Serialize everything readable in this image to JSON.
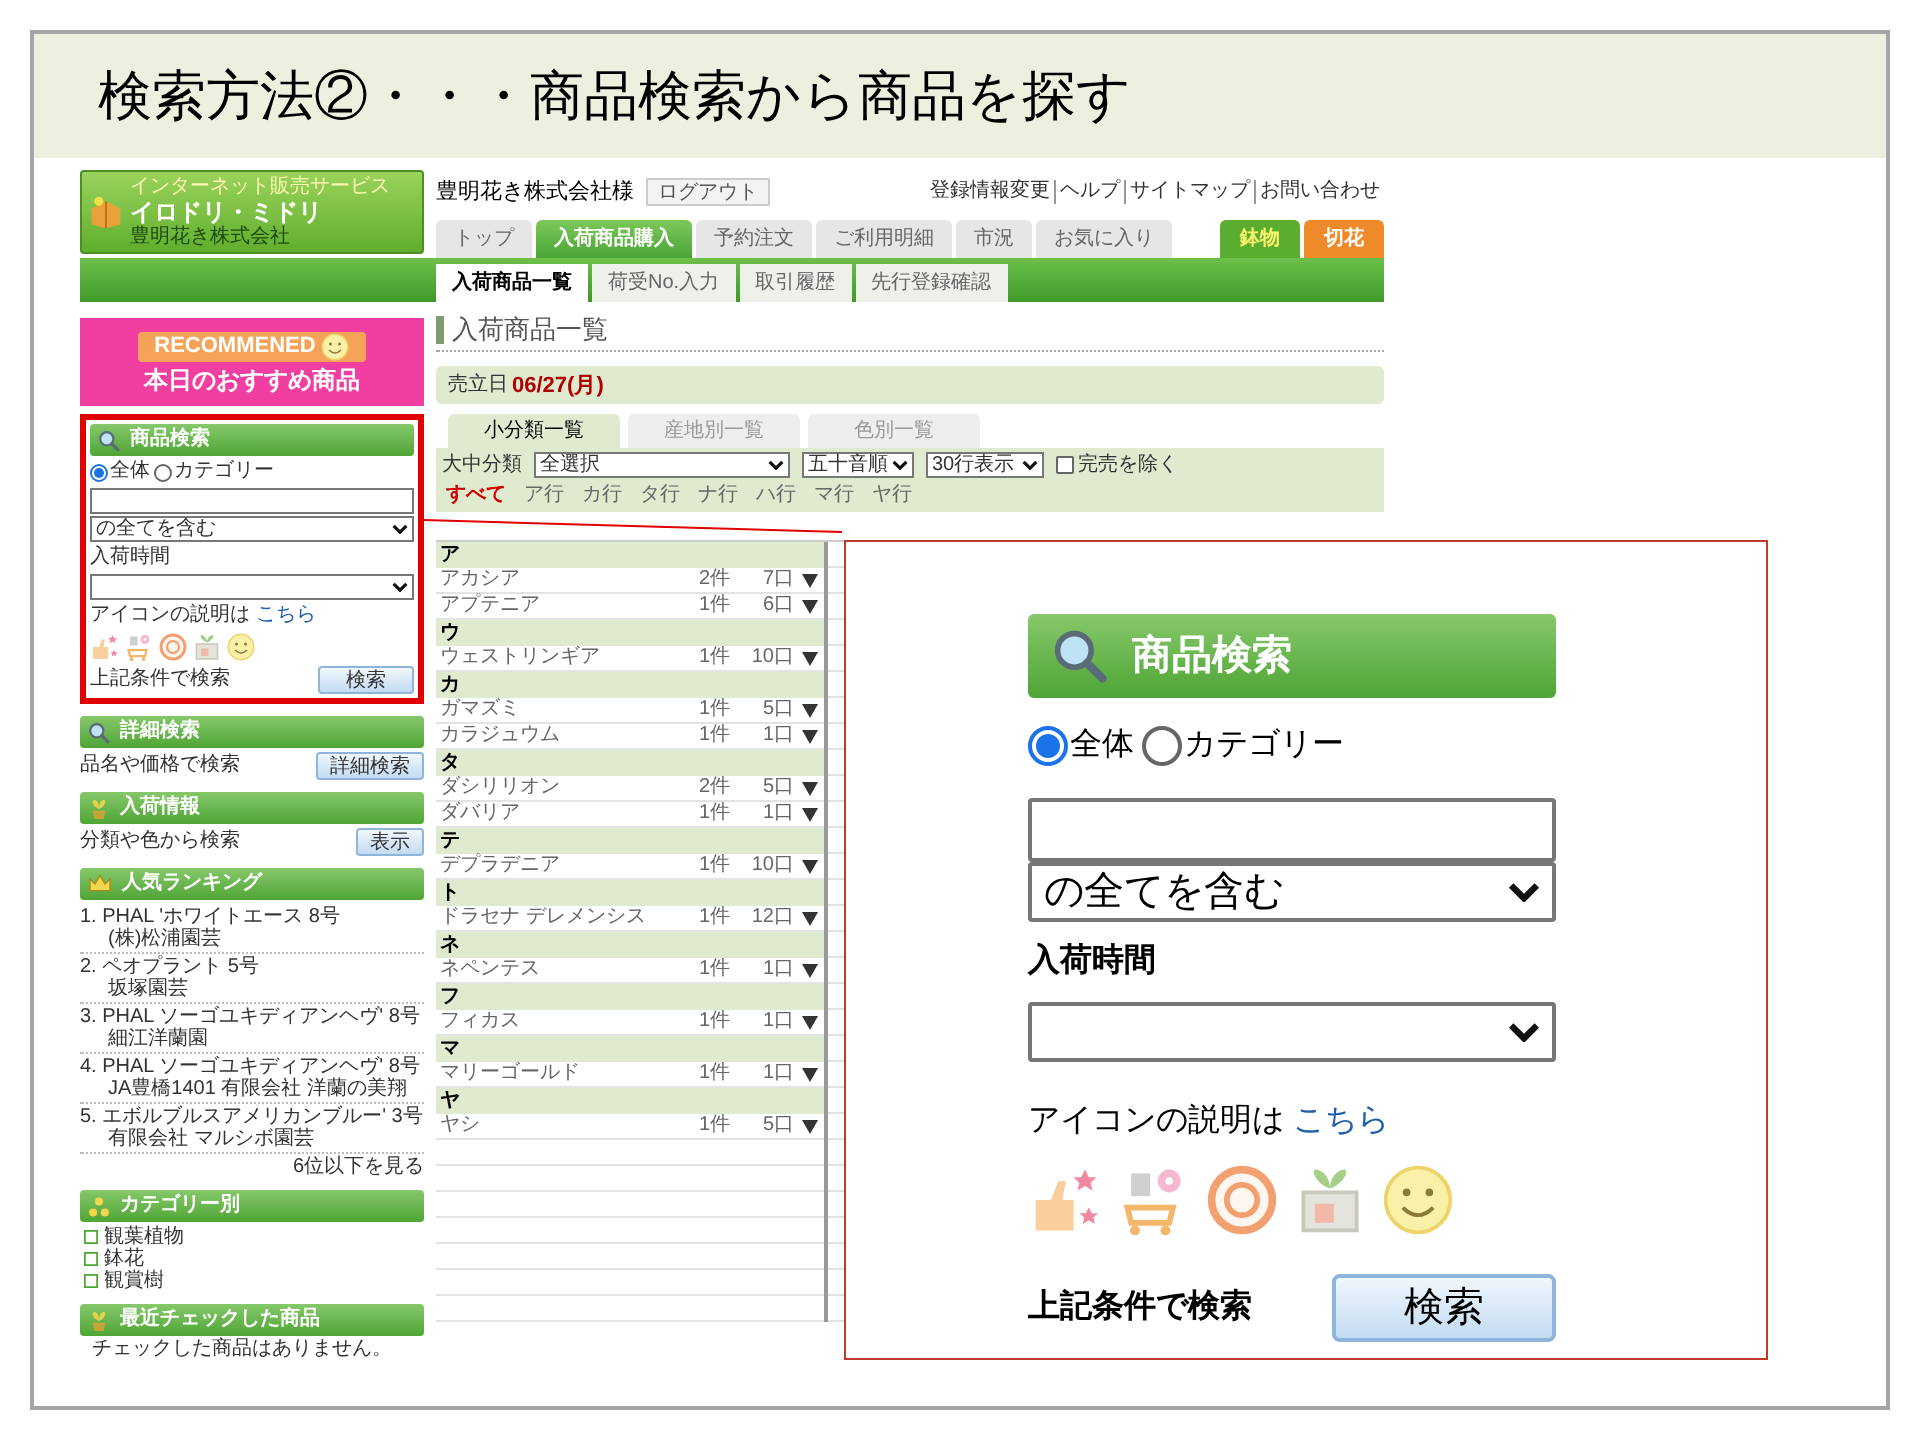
{
  "slide": {
    "title": "検索方法②・・・商品検索から商品を探す"
  },
  "header": {
    "logo": {
      "tagline": "インターネット販売サービス",
      "name": "イロドリ・ミドリ",
      "company": "豊明花き株式会社"
    },
    "user": "豊明花き株式会社様",
    "logout": "ログアウト",
    "links": [
      "登録情報変更",
      "ヘルプ",
      "サイトマップ",
      "お問い合わせ"
    ]
  },
  "nav": {
    "tabs": [
      {
        "label": "トップ",
        "selected": false
      },
      {
        "label": "入荷商品購入",
        "selected": true
      },
      {
        "label": "予約注文",
        "selected": false
      },
      {
        "label": "ご利用明細",
        "selected": false
      },
      {
        "label": "市況",
        "selected": false
      },
      {
        "label": "お気に入り",
        "selected": false
      }
    ],
    "markets": [
      {
        "label": "鉢物",
        "color": "#5aad2f"
      },
      {
        "label": "切花",
        "color": "#ee8a2a"
      }
    ],
    "sub_tabs": [
      {
        "label": "入荷商品一覧",
        "selected": true
      },
      {
        "label": "荷受No.入力",
        "selected": false
      },
      {
        "label": "取引履歴",
        "selected": false
      },
      {
        "label": "先行登録確認",
        "selected": false
      }
    ]
  },
  "sidebar": {
    "banner": {
      "badge": "RECOMMENED",
      "text": "本日のおすすめ商品"
    },
    "search": {
      "title": "商品検索",
      "scope": [
        {
          "label": "全体",
          "selected": true
        },
        {
          "label": "カテゴリー",
          "selected": false
        }
      ],
      "keyword_mode": "の全てを含む",
      "time_label": "入荷時間",
      "icon_note": "アイコンの説明は",
      "icon_link": "こちら",
      "submit_label": "上記条件で検索",
      "submit": "検索"
    },
    "detail": {
      "title": "詳細検索",
      "note": "品名や価格で検索",
      "button": "詳細検索"
    },
    "arrivals": {
      "title": "入荷情報",
      "note": "分類や色から検索",
      "button": "表示"
    },
    "ranking": {
      "title": "人気ランキング",
      "entries": [
        {
          "name": "1. PHAL 'ホワイトエース 8号",
          "grower": "(株)松浦園芸"
        },
        {
          "name": "2. ペオプラント 5号",
          "grower": "坂塚園芸"
        },
        {
          "name": "3. PHAL ソーゴユキディアンヘヴ' 8号",
          "grower": "細江洋蘭園"
        },
        {
          "name": "4. PHAL ソーゴユキディアンヘヴ' 8号",
          "grower": "JA豊橋1401 有限会社 洋蘭の美翔"
        },
        {
          "name": "5. エボルブルスアメリカンブルー' 3号",
          "grower": "有限会社 マルシボ園芸"
        }
      ],
      "more": "6位以下を見る"
    },
    "categories": {
      "title": "カテゴリー別",
      "items": [
        "観葉植物",
        "鉢花",
        "観賞樹"
      ]
    },
    "recent": {
      "title": "最近チェックした商品",
      "empty": "チェックした商品はありません。"
    }
  },
  "main": {
    "title": "入荷商品一覧",
    "date_label": "売立日",
    "date": "06/27(月)",
    "views": [
      {
        "label": "小分類一覧",
        "selected": true
      },
      {
        "label": "産地別一覧",
        "selected": false
      },
      {
        "label": "色別一覧",
        "selected": false
      }
    ],
    "filters": {
      "class_label": "大中分類",
      "class_value": "全選択",
      "sort": "五十音順",
      "rows": "30行表示",
      "exclude_label": "完売を除く",
      "exclude": false
    },
    "kana": [
      {
        "label": "すべて",
        "selected": true
      },
      {
        "label": "ア行",
        "selected": false
      },
      {
        "label": "カ行",
        "selected": false
      },
      {
        "label": "タ行",
        "selected": false
      },
      {
        "label": "ナ行",
        "selected": false
      },
      {
        "label": "ハ行",
        "selected": false
      },
      {
        "label": "マ行",
        "selected": false
      },
      {
        "label": "ヤ行",
        "selected": false
      }
    ],
    "groups": [
      {
        "heading": "ア",
        "items": [
          {
            "name": "アカシア",
            "count": "2件",
            "qty": "7口"
          },
          {
            "name": "アプテニア",
            "count": "1件",
            "qty": "6口"
          }
        ]
      },
      {
        "heading": "ウ",
        "items": [
          {
            "name": "ウェストリンギア",
            "count": "1件",
            "qty": "10口"
          }
        ]
      },
      {
        "heading": "カ",
        "items": [
          {
            "name": "ガマズミ",
            "count": "1件",
            "qty": "5口"
          },
          {
            "name": "カラジュウム",
            "count": "1件",
            "qty": "1口"
          }
        ]
      },
      {
        "heading": "タ",
        "items": [
          {
            "name": "ダシリリオン",
            "count": "2件",
            "qty": "5口"
          },
          {
            "name": "ダバリア",
            "count": "1件",
            "qty": "1口"
          }
        ]
      },
      {
        "heading": "テ",
        "items": [
          {
            "name": "デプラデニア",
            "count": "1件",
            "qty": "10口"
          }
        ]
      },
      {
        "heading": "ト",
        "items": [
          {
            "name": "ドラセナ デレメンシス",
            "count": "1件",
            "qty": "12口"
          }
        ]
      },
      {
        "heading": "ネ",
        "items": [
          {
            "name": "ネペンテス",
            "count": "1件",
            "qty": "1口"
          }
        ]
      },
      {
        "heading": "フ",
        "items": [
          {
            "name": "フィカス",
            "count": "1件",
            "qty": "1口"
          }
        ]
      },
      {
        "heading": "マ",
        "items": [
          {
            "name": "マリーゴールド",
            "count": "1件",
            "qty": "1口"
          }
        ]
      },
      {
        "heading": "ヤ",
        "items": [
          {
            "name": "ヤシ",
            "count": "1件",
            "qty": "5口"
          }
        ]
      }
    ]
  },
  "callout": {
    "search": {
      "title": "商品検索",
      "scope": [
        {
          "label": "全体",
          "selected": true
        },
        {
          "label": "カテゴリー",
          "selected": false
        }
      ],
      "keyword_mode": "の全てを含む",
      "time_label": "入荷時間",
      "icon_note": "アイコンの説明は",
      "icon_link": "こちら",
      "submit_label": "上記条件で検索",
      "submit": "検索"
    }
  }
}
